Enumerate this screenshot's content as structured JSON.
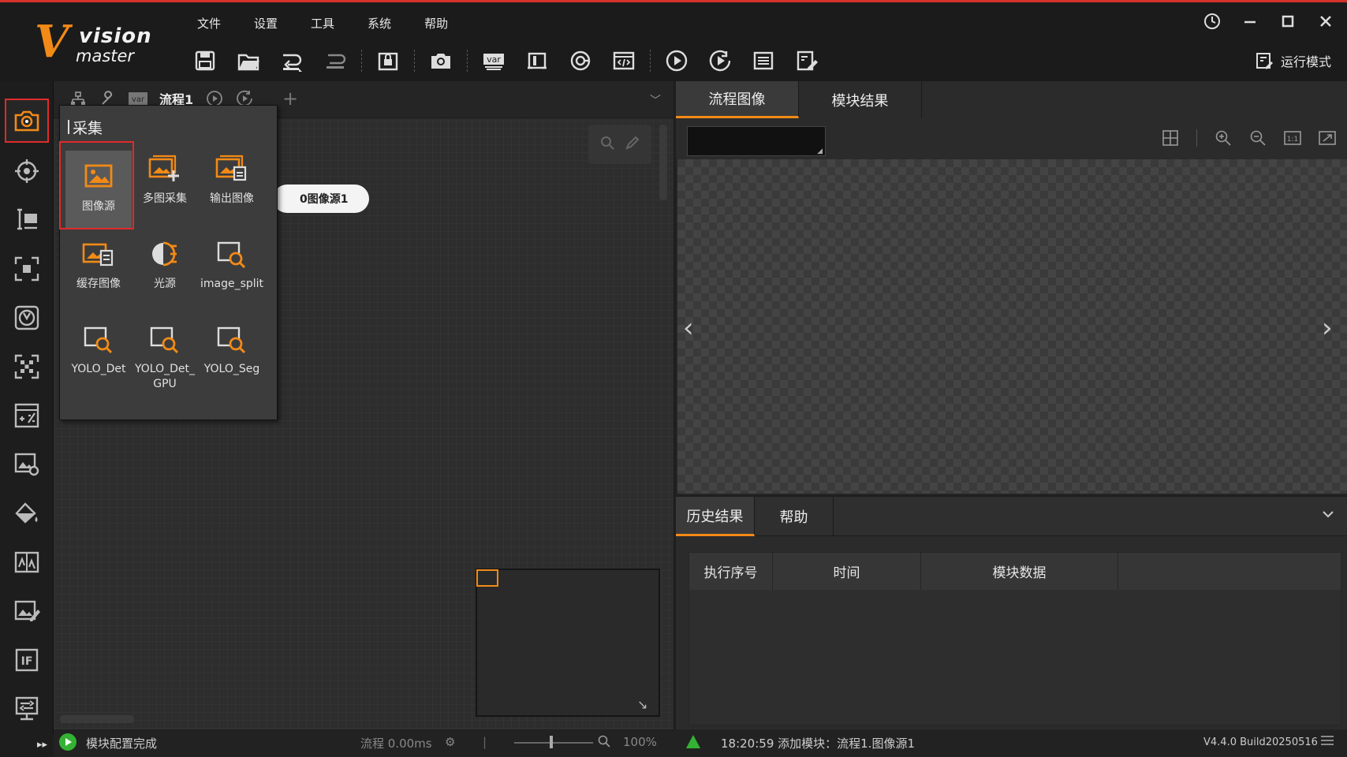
{
  "app": {
    "logo_vision": "vision",
    "logo_master": "master",
    "accent_color": "#f28a17",
    "highlight_color": "#e02b2b"
  },
  "menu": [
    "文件",
    "设置",
    "工具",
    "系统",
    "帮助"
  ],
  "toolbar_icons": [
    "save-icon",
    "open-folder-icon",
    "import-icon",
    "export-icon",
    "lock-save-icon",
    "camera-icon",
    "var-icon",
    "device-icon",
    "register-icon",
    "script-icon",
    "run-once-icon",
    "run-loop-icon",
    "settings-list-icon",
    "form-edit-icon"
  ],
  "window": {
    "run_mode_label": "运行模式"
  },
  "sidebar_icons": [
    "camera-icon",
    "locate-icon",
    "measure-icon",
    "recognize-icon",
    "calibrate-icon",
    "align-icon",
    "calculate-icon",
    "image-process-icon",
    "color-icon",
    "defect-icon",
    "edit-image-icon",
    "if-logic-icon",
    "communication-icon"
  ],
  "flow": {
    "tab_label": "流程1",
    "node_label": "0图像源1"
  },
  "popup": {
    "title": "采集",
    "tools": [
      {
        "label": "图像源",
        "icon": "image-source-icon"
      },
      {
        "label": "多图采集",
        "icon": "multi-image-icon"
      },
      {
        "label": "输出图像",
        "icon": "output-image-icon"
      },
      {
        "label": "缓存图像",
        "icon": "cache-image-icon"
      },
      {
        "label": "光源",
        "icon": "light-source-icon"
      },
      {
        "label": "image_split",
        "icon": "image-split-icon"
      },
      {
        "label": "YOLO_Det",
        "icon": "yolo-det-icon"
      },
      {
        "label": "YOLO_Det_\nGPU",
        "icon": "yolo-det-gpu-icon"
      },
      {
        "label": "YOLO_Seg",
        "icon": "yolo-seg-icon"
      }
    ]
  },
  "image_panel": {
    "tabs": [
      "流程图像",
      "模块结果"
    ]
  },
  "results": {
    "tabs": [
      "历史结果",
      "帮助"
    ],
    "columns": [
      "执行序号",
      "时间",
      "模块数据"
    ]
  },
  "status": {
    "left_message": "模块配置完成",
    "flow_time": "流程  0.00ms",
    "zoom": "100%",
    "log_message": "18:20:59  添加模块：流程1.图像源1",
    "version": "V4.4.0 Build20250516"
  }
}
